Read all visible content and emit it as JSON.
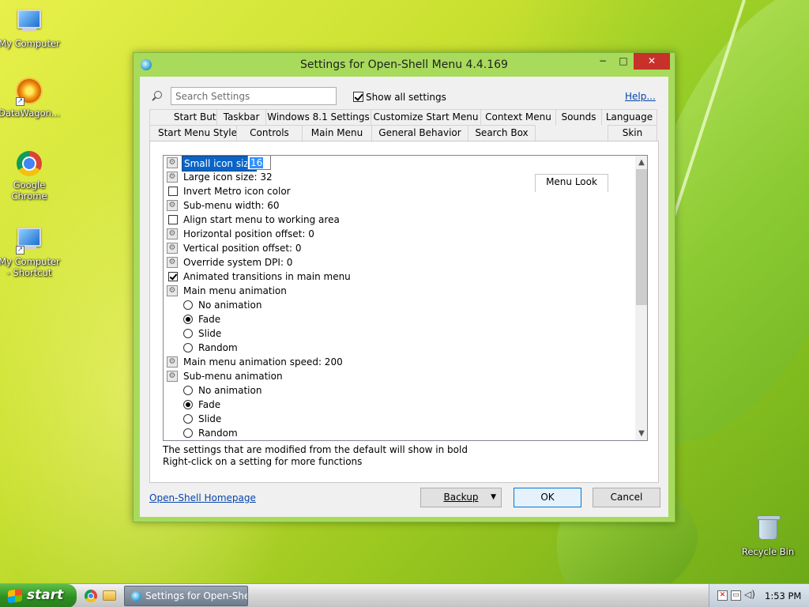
{
  "desktop": {
    "icons": [
      {
        "label": "My Computer"
      },
      {
        "label": "DataWagon..."
      },
      {
        "label": "Google Chrome"
      },
      {
        "label": "My Computer - Shortcut"
      },
      {
        "label": "Recycle Bin"
      }
    ]
  },
  "window": {
    "title": "Settings for Open-Shell Menu 4.4.169",
    "minimize": "−",
    "maximize": "□",
    "close": "✕"
  },
  "search": {
    "placeholder": "Search Settings",
    "value": ""
  },
  "show_all": {
    "label": "Show all settings",
    "checked": true
  },
  "help_link": "Help...",
  "tabs_row1": [
    "Start Button",
    "Taskbar",
    "Windows 8.1 Settings",
    "Customize Start Menu",
    "Context Menu",
    "Sounds",
    "Language"
  ],
  "tabs_row2": [
    "Start Menu Style",
    "Controls",
    "Main Menu",
    "General Behavior",
    "Search Box",
    "Menu Look",
    "Skin"
  ],
  "active_tab": "Menu Look",
  "settings": {
    "small_icon_label": "Small icon size",
    "small_icon_value": "16",
    "large_icon": "Large icon size: 32",
    "invert_metro": "Invert Metro icon color",
    "submenu_width": "Sub-menu width: 60",
    "align_start": "Align start menu to working area",
    "h_offset": "Horizontal position offset: 0",
    "v_offset": "Vertical position offset: 0",
    "override_dpi": "Override system DPI: 0",
    "animated_transitions": "Animated transitions in main menu",
    "main_anim": "Main menu animation",
    "main_anim_options": [
      "No animation",
      "Fade",
      "Slide",
      "Random"
    ],
    "main_anim_speed": "Main menu animation speed: 200",
    "sub_anim": "Sub-menu animation",
    "sub_anim_options": [
      "No animation",
      "Fade",
      "Slide",
      "Random"
    ]
  },
  "notes": {
    "line1": "The settings that are modified from the default will show in bold",
    "line2": "Right-click on a setting for more functions"
  },
  "footer": {
    "homepage_link": "Open-Shell Homepage",
    "backup": "Backup",
    "ok": "OK",
    "cancel": "Cancel"
  },
  "taskbar": {
    "start_label": "start",
    "task_label": "Settings for Open-Shel...",
    "clock": "1:53 PM"
  }
}
